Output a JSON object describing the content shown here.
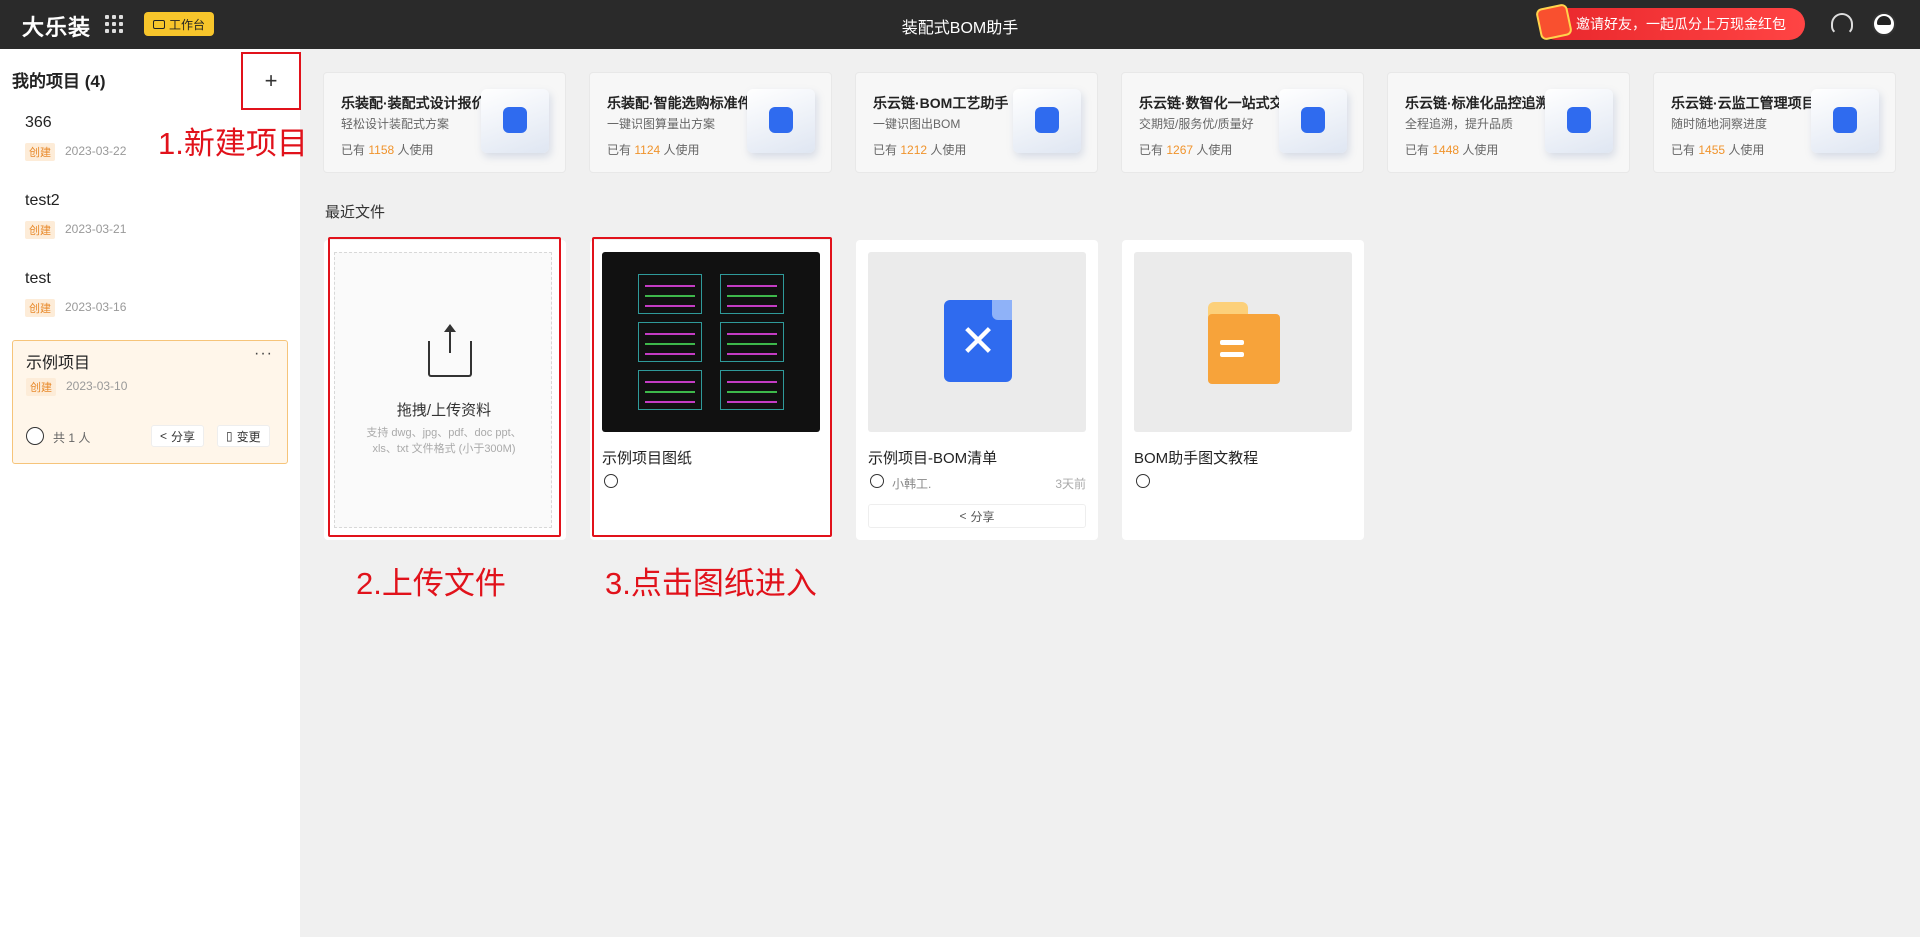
{
  "header": {
    "logo": "大乐装",
    "workbench_label": "工作台",
    "title": "装配式BOM助手",
    "invite_text": "邀请好友，一起瓜分上万现金红包"
  },
  "sidebar": {
    "heading": "我的项目 (4)",
    "add_label": "+",
    "projects": [
      {
        "name": "366",
        "tag": "创建",
        "date": "2023-03-22"
      },
      {
        "name": "test2",
        "tag": "创建",
        "date": "2023-03-21"
      },
      {
        "name": "test",
        "tag": "创建",
        "date": "2023-03-16"
      },
      {
        "name": "示例项目",
        "tag": "创建",
        "date": "2023-03-10",
        "more": "···",
        "members": "共 1 人",
        "share": "分享",
        "change": "变更"
      }
    ]
  },
  "annotations": {
    "a1": "1.新建项目",
    "a2": "2.上传文件",
    "a3": "3.点击图纸进入"
  },
  "tools": [
    {
      "title": "乐装配·装配式设计报价",
      "desc": "轻松设计装配式方案",
      "pre": "已有",
      "count": "1158",
      "post": "人使用"
    },
    {
      "title": "乐装配·智能选购标准件",
      "desc": "一键识图算量出方案",
      "pre": "已有",
      "count": "1124",
      "post": "人使用"
    },
    {
      "title": "乐云链·BOM工艺助手",
      "desc": "一键识图出BOM",
      "pre": "已有",
      "count": "1212",
      "post": "人使用"
    },
    {
      "title": "乐云链·数智化一站式交付",
      "desc": "交期短/服务优/质量好",
      "pre": "已有",
      "count": "1267",
      "post": "人使用"
    },
    {
      "title": "乐云链·标准化品控追溯",
      "desc": "全程追溯，提升品质",
      "pre": "已有",
      "count": "1448",
      "post": "人使用"
    },
    {
      "title": "乐云链·云监工管理项目",
      "desc": "随时随地洞察进度",
      "pre": "已有",
      "count": "1455",
      "post": "人使用"
    }
  ],
  "recent": {
    "label": "最近文件",
    "upload_title": "拖拽/上传资料",
    "upload_hint": "支持 dwg、jpg、pdf、doc ppt、xls、txt 文件格式 (小于300M)",
    "files": [
      {
        "name": "示例项目图纸"
      },
      {
        "name": "示例项目-BOM清单",
        "owner": "小韩工.",
        "ago": "3天前",
        "share": "分享",
        "icon": "x-doc-icon"
      },
      {
        "name": "BOM助手图文教程",
        "icon": "folder-icon"
      }
    ]
  },
  "colors": {
    "accent_red": "#e1121b",
    "brand_yellow": "#f7c52b",
    "count_orange": "#f0932b",
    "tag_orange": "#e88a2b"
  }
}
